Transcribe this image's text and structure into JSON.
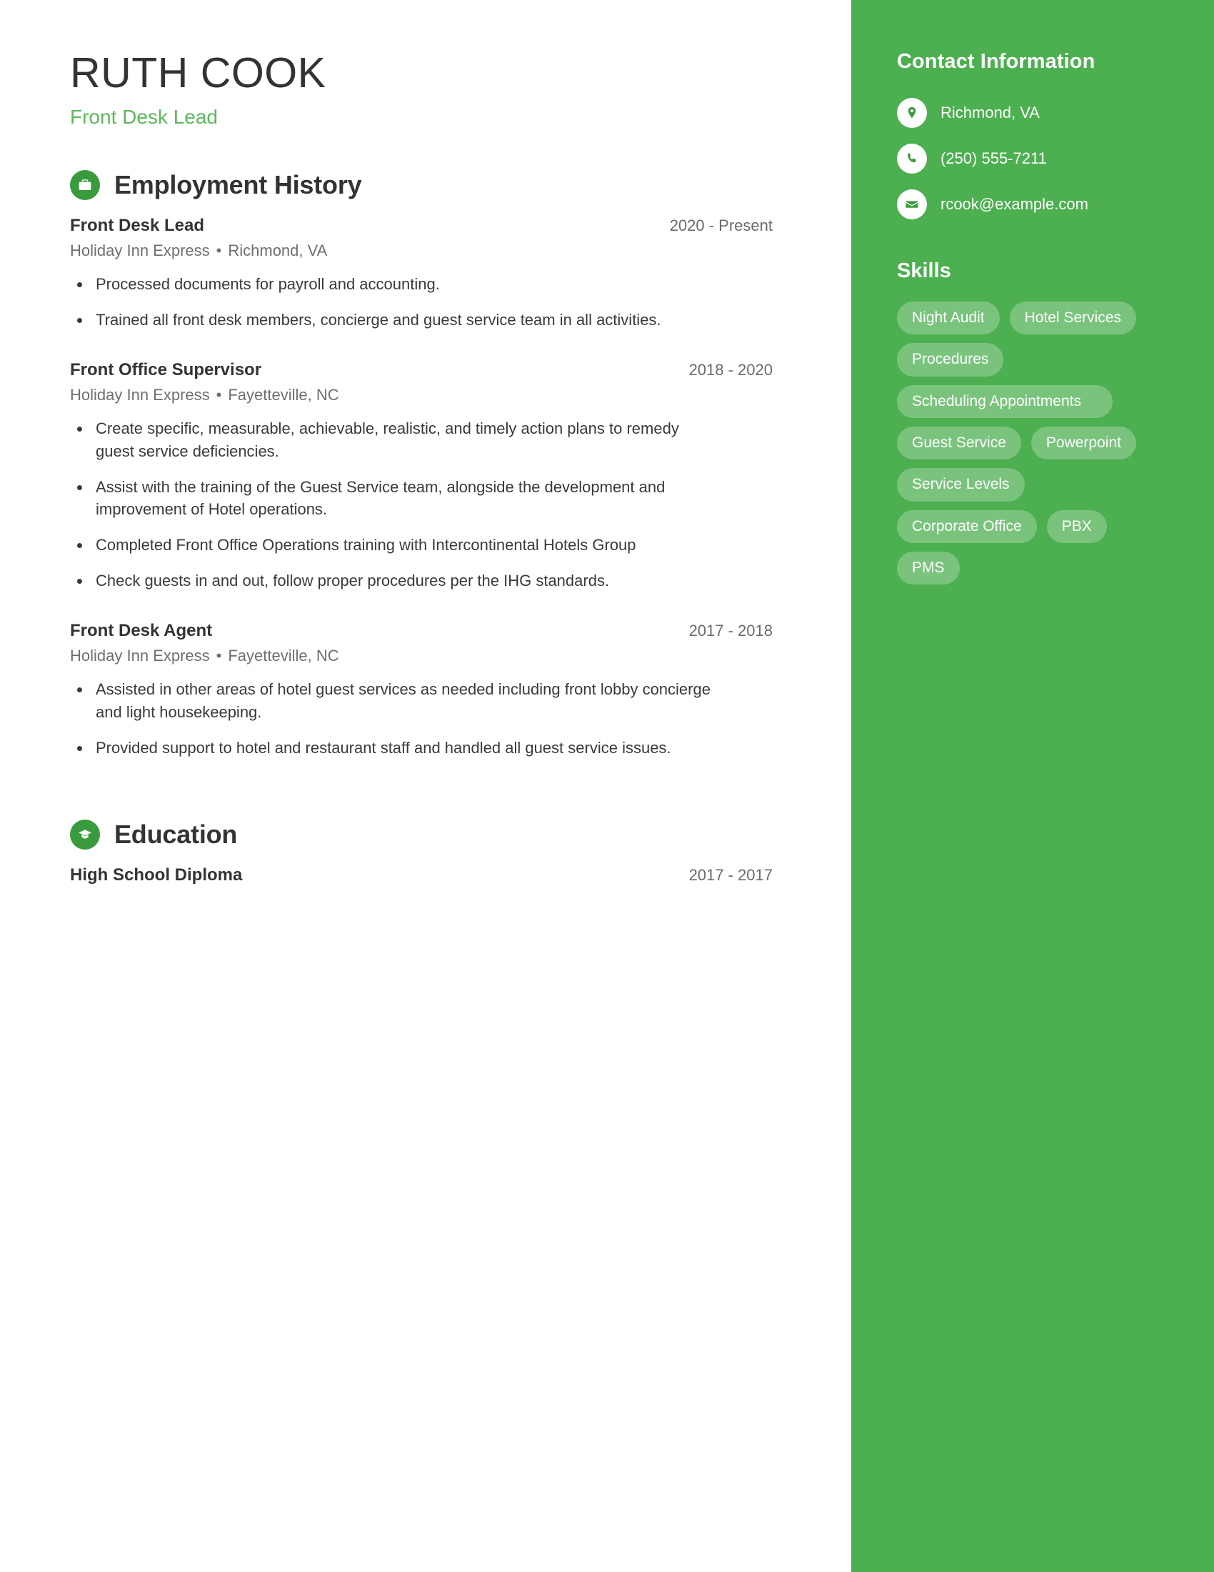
{
  "header": {
    "name": "RUTH COOK",
    "title": "Front Desk Lead"
  },
  "colors": {
    "sidebar_green": "#4CAF50",
    "accent_green": "#5CB85C",
    "icon_circle_green": "#3A9A3E",
    "body_text": "#3a3a3a",
    "muted_text": "#6f6f6f"
  },
  "sections": {
    "employment": {
      "heading": "Employment History",
      "icon": "briefcase-icon",
      "jobs": [
        {
          "title": "Front Desk Lead",
          "company": "Holiday Inn Express",
          "location": "Richmond, VA",
          "separator": "•",
          "dates": "2020 - Present",
          "bullets": [
            "Processed documents for payroll and accounting.",
            "Trained all front desk members, concierge and guest service team in all activities."
          ]
        },
        {
          "title": "Front Office Supervisor",
          "company": "Holiday Inn Express",
          "location": "Fayetteville, NC",
          "separator": "•",
          "dates": "2018 - 2020",
          "bullets": [
            "Create specific, measurable, achievable, realistic, and timely action plans to remedy guest service deficiencies.",
            "Assist with the training of the Guest Service team, alongside the development and improvement of Hotel operations.",
            "Completed Front Office Operations training with Intercontinental Hotels Group",
            "Check guests in and out, follow proper procedures per the IHG standards."
          ]
        },
        {
          "title": "Front Desk Agent",
          "company": "Holiday Inn Express",
          "location": "Fayetteville, NC",
          "separator": "•",
          "dates": "2017 - 2018",
          "bullets": [
            "Assisted in other areas of hotel guest services as needed including front lobby concierge and light housekeeping.",
            "Provided support to hotel and restaurant staff and handled all guest service issues."
          ]
        }
      ]
    },
    "education": {
      "heading": "Education",
      "icon": "graduation-cap-icon",
      "entries": [
        {
          "degree": "High School Diploma",
          "dates": "2017 - 2017"
        }
      ]
    }
  },
  "sidebar": {
    "contact": {
      "heading": "Contact Information",
      "items": [
        {
          "icon": "location-pin-icon",
          "value": "Richmond, VA"
        },
        {
          "icon": "phone-icon",
          "value": "(250) 555-7211"
        },
        {
          "icon": "envelope-icon",
          "value": "rcook@example.com"
        }
      ]
    },
    "skills": {
      "heading": "Skills",
      "items": [
        {
          "label": "Night Audit",
          "wide": false
        },
        {
          "label": "Hotel Services",
          "wide": false
        },
        {
          "label": "Procedures",
          "wide": false
        },
        {
          "label": "Scheduling Appointments",
          "wide": true
        },
        {
          "label": "Guest Service",
          "wide": false
        },
        {
          "label": "Powerpoint",
          "wide": false
        },
        {
          "label": "Service Levels",
          "wide": false
        },
        {
          "label": "Corporate Office",
          "wide": false
        },
        {
          "label": "PBX",
          "wide": false
        },
        {
          "label": "PMS",
          "wide": false
        }
      ]
    }
  }
}
